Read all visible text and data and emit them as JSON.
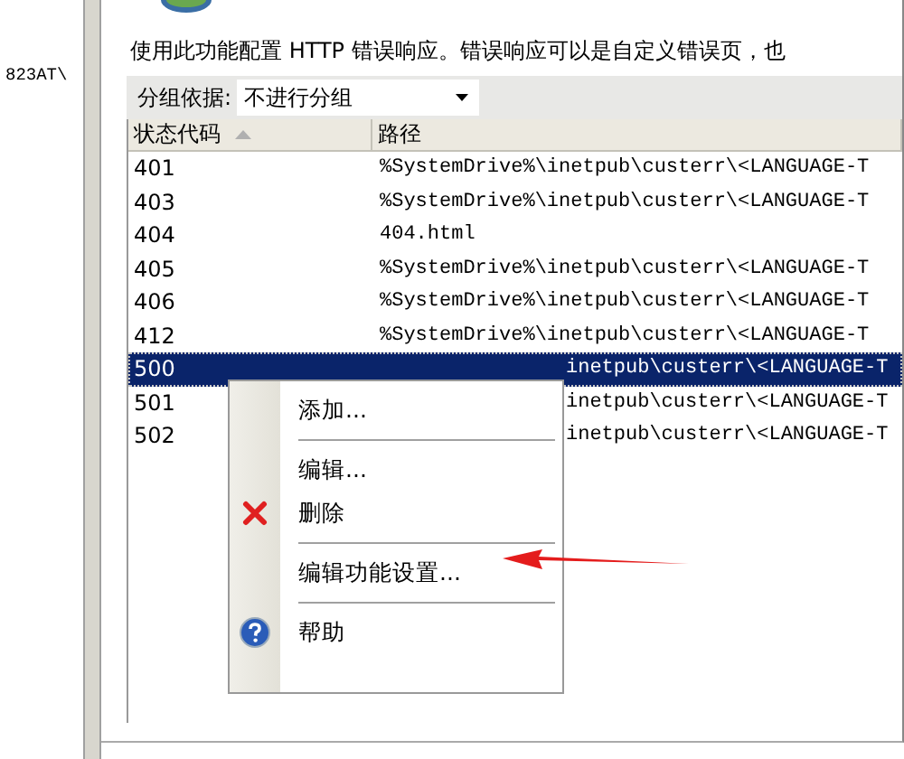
{
  "left_pane": {
    "text": "823AT\\"
  },
  "description": "使用此功能配置 HTTP 错误响应。错误响应可以是自定义错误页，也",
  "group_by": {
    "label": "分组依据:",
    "value": "不进行分组"
  },
  "table": {
    "columns": [
      {
        "label": "状态代码",
        "sorted": true
      },
      {
        "label": "路径",
        "sorted": false
      }
    ],
    "rows": [
      {
        "code": "401",
        "path": "%SystemDrive%\\inetpub\\custerr\\<LANGUAGE-T",
        "selected": false,
        "covered": false
      },
      {
        "code": "403",
        "path": "%SystemDrive%\\inetpub\\custerr\\<LANGUAGE-T",
        "selected": false,
        "covered": false
      },
      {
        "code": "404",
        "path": "404.html",
        "selected": false,
        "covered": false
      },
      {
        "code": "405",
        "path": "%SystemDrive%\\inetpub\\custerr\\<LANGUAGE-T",
        "selected": false,
        "covered": false
      },
      {
        "code": "406",
        "path": "%SystemDrive%\\inetpub\\custerr\\<LANGUAGE-T",
        "selected": false,
        "covered": false
      },
      {
        "code": "412",
        "path": "%SystemDrive%\\inetpub\\custerr\\<LANGUAGE-T",
        "selected": false,
        "covered": false
      },
      {
        "code": "500",
        "path": "inetpub\\custerr\\<LANGUAGE-T",
        "selected": true,
        "covered": true
      },
      {
        "code": "501",
        "path": "inetpub\\custerr\\<LANGUAGE-T",
        "selected": false,
        "covered": true
      },
      {
        "code": "502",
        "path": "inetpub\\custerr\\<LANGUAGE-T",
        "selected": false,
        "covered": true
      }
    ]
  },
  "context_menu": {
    "items": [
      {
        "kind": "item",
        "label": "添加..."
      },
      {
        "kind": "separator"
      },
      {
        "kind": "item",
        "label": "编辑..."
      },
      {
        "kind": "delete",
        "label": "删除"
      },
      {
        "kind": "separator"
      },
      {
        "kind": "item",
        "label": "编辑功能设置..."
      },
      {
        "kind": "separator"
      },
      {
        "kind": "help",
        "label": "帮助"
      }
    ]
  }
}
